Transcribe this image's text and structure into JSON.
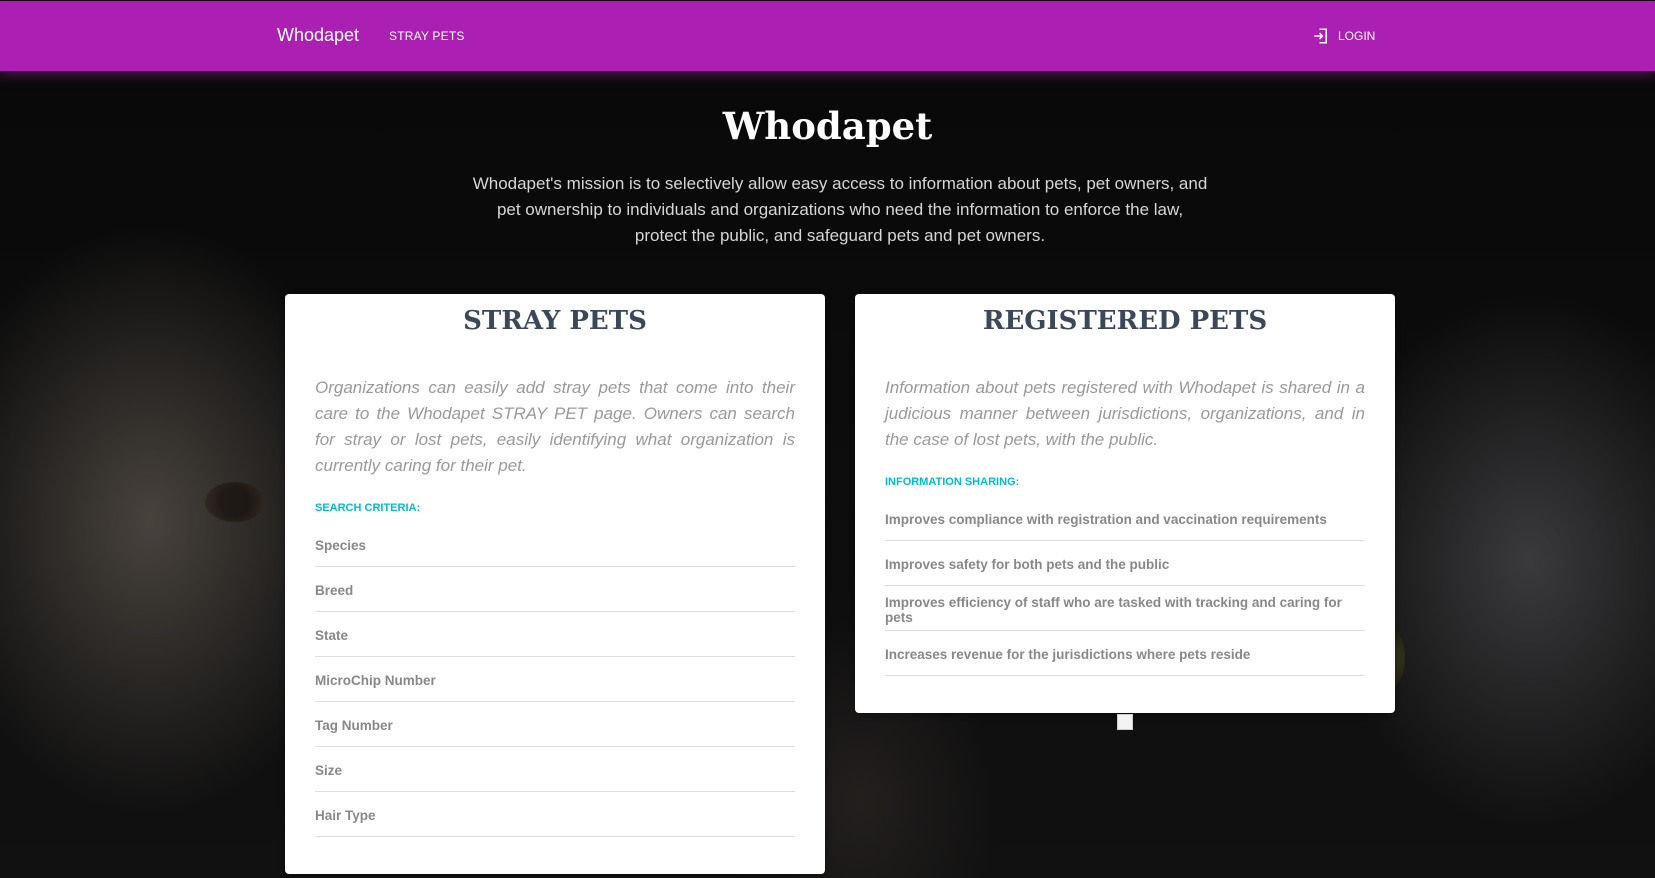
{
  "nav": {
    "brand": "Whodapet",
    "links": [
      "STRAY PETS"
    ],
    "login_label": "LOGIN",
    "color": "#ab20b3"
  },
  "hero": {
    "title": "Whodapet",
    "text": "Whodapet's mission is to selectively allow easy access to information about pets, pet owners, and pet ownership to individuals and organizations who need the information to enforce the law, protect the public, and safeguard pets and pet owners."
  },
  "stray": {
    "title": "STRAY PETS",
    "description": "Organizations can easily add stray pets that come into their care to the Whodapet STRAY PET page. Owners can search for stray or lost pets, easily identifying what organization is currently caring for their pet.",
    "sub_heading": "SEARCH CRITERIA:",
    "items": [
      "Species",
      "Breed",
      "State",
      "MicroChip Number",
      "Tag Number",
      "Size",
      "Hair Type"
    ]
  },
  "registered": {
    "title": "REGISTERED PETS",
    "description": "Information about pets registered with Whodapet is shared in a judicious manner between jurisdictions, organizations, and in the case of lost pets, with the public.",
    "sub_heading": "INFORMATION SHARING:",
    "items": [
      "Improves compliance with registration and vaccination requirements",
      "Improves safety for both pets and the public",
      "Improves efficiency of staff who are tasked with tracking and caring for pets",
      "Increases revenue for the jurisdictions where pets reside"
    ]
  },
  "colors": {
    "accent": "#00bcd4",
    "title": "#3c4858"
  }
}
